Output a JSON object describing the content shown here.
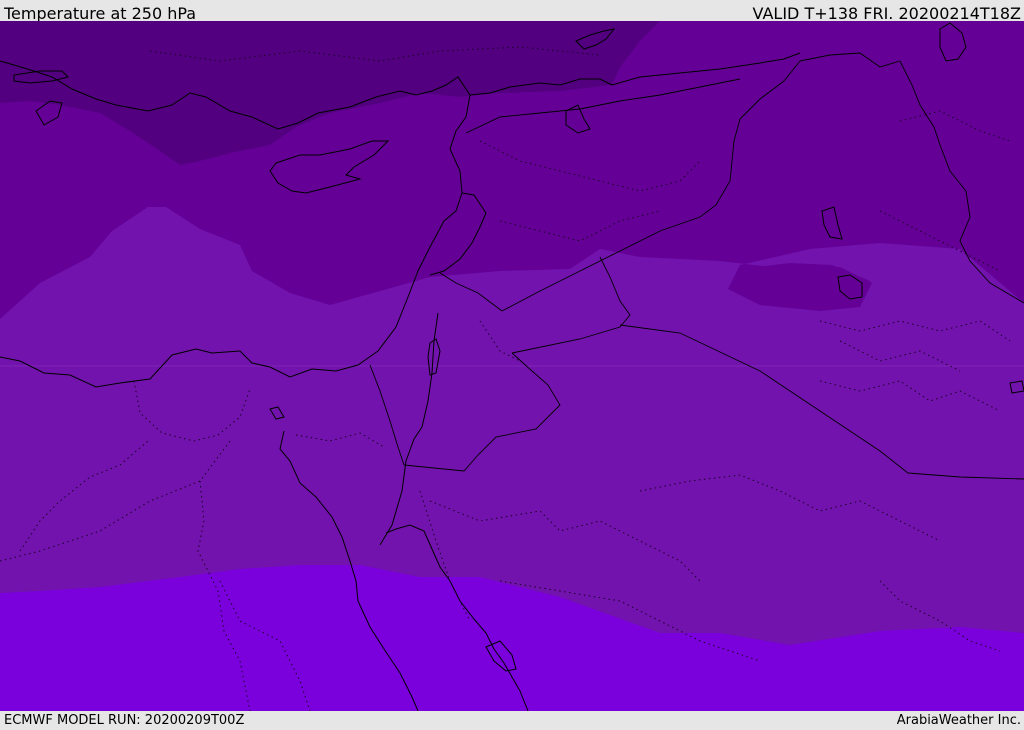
{
  "header": {
    "title": "Temperature at 250 hPa",
    "valid": "VALID T+138 FRI. 20200214T18Z"
  },
  "footer": {
    "model_run": "ECMWF MODEL RUN: 20200209T00Z",
    "credit": "ArabiaWeather Inc."
  },
  "map": {
    "field": "temperature",
    "level": "250 hPa",
    "colors": {
      "band_coldest": "#520080",
      "band_cold": "#640096",
      "band_mid": "#7213ad",
      "band_warm": "#7a00dc",
      "coastline": "#000000",
      "border": "#000000",
      "admin_border": "#1a0026"
    },
    "features": [
      "coastlines",
      "country borders",
      "dotted administrative boundaries"
    ]
  }
}
